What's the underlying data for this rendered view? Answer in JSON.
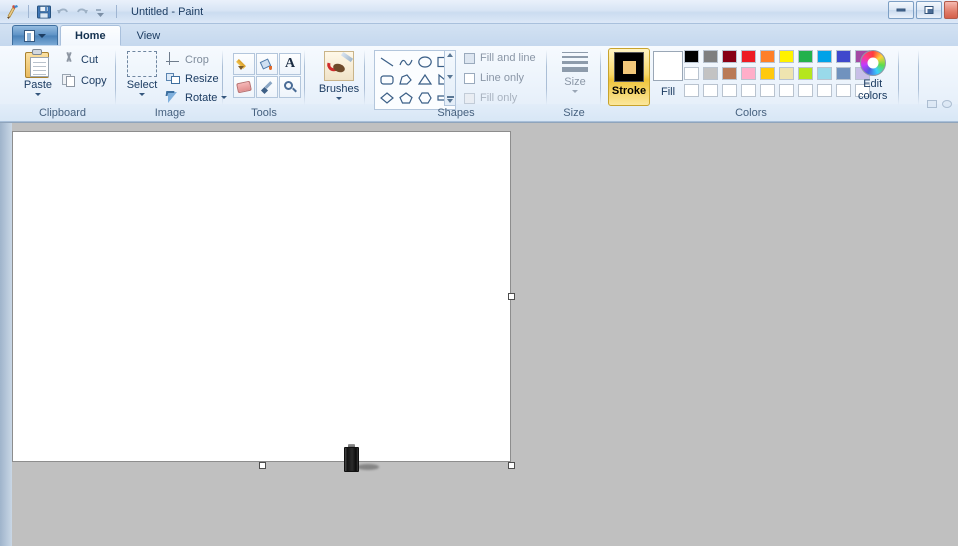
{
  "window": {
    "title": "Untitled - Paint",
    "quick_access": [
      {
        "name": "paint-app-icon",
        "label": "Paint"
      },
      {
        "name": "save-icon",
        "label": "Save"
      },
      {
        "name": "undo-icon",
        "label": "Undo"
      },
      {
        "name": "redo-icon",
        "label": "Redo"
      },
      {
        "name": "customize-qat-icon",
        "label": "Customize Quick Access Toolbar"
      }
    ],
    "controls": [
      {
        "name": "minimize-button",
        "label": "Minimize"
      },
      {
        "name": "restore-button",
        "label": "Restore Down"
      },
      {
        "name": "close-button",
        "label": "Close"
      }
    ]
  },
  "tabs": {
    "app_button_label": "File",
    "items": [
      {
        "label": "Home",
        "active": true
      },
      {
        "label": "View",
        "active": false
      }
    ]
  },
  "ribbon": {
    "groups": [
      {
        "label": "Clipboard"
      },
      {
        "label": "Image"
      },
      {
        "label": "Tools"
      },
      {
        "label": "Shapes"
      },
      {
        "label": "Size"
      },
      {
        "label": "Colors"
      }
    ],
    "clipboard": {
      "paste_label": "Paste",
      "cut_label": "Cut",
      "copy_label": "Copy"
    },
    "image": {
      "select_label": "Select",
      "crop_label": "Crop",
      "resize_label": "Resize",
      "rotate_label": "Rotate"
    },
    "tools": {
      "items": [
        {
          "name": "pencil-tool",
          "label": "Pencil"
        },
        {
          "name": "fill-tool",
          "label": "Fill with color"
        },
        {
          "name": "text-tool",
          "label": "Text"
        },
        {
          "name": "eraser-tool",
          "label": "Eraser"
        },
        {
          "name": "color-picker-tool",
          "label": "Color picker"
        },
        {
          "name": "magnifier-tool",
          "label": "Magnifier"
        }
      ],
      "text_glyph": "A"
    },
    "brushes": {
      "label": "Brushes"
    },
    "shapes": {
      "items": [
        {
          "name": "shape-line",
          "label": "Line"
        },
        {
          "name": "shape-curve",
          "label": "Curve"
        },
        {
          "name": "shape-oval",
          "label": "Oval"
        },
        {
          "name": "shape-rectangle",
          "label": "Rectangle"
        },
        {
          "name": "shape-rounded-rectangle",
          "label": "Rounded rectangle"
        },
        {
          "name": "shape-polygon",
          "label": "Polygon"
        },
        {
          "name": "shape-triangle",
          "label": "Triangle"
        },
        {
          "name": "shape-right-triangle",
          "label": "Right triangle"
        },
        {
          "name": "shape-diamond",
          "label": "Diamond"
        },
        {
          "name": "shape-pentagon",
          "label": "Pentagon"
        },
        {
          "name": "shape-hexagon",
          "label": "Hexagon"
        },
        {
          "name": "shape-right-arrow",
          "label": "Right arrow"
        }
      ],
      "fill_options": [
        {
          "label": "Fill and line",
          "disabled": false
        },
        {
          "label": "Line only",
          "disabled": false
        },
        {
          "label": "Fill only",
          "disabled": true
        }
      ]
    },
    "size": {
      "label": "Size"
    },
    "colors": {
      "stroke_label": "Stroke",
      "fill_label": "Fill",
      "stroke_color": "#000000",
      "stroke_inner_color": "#f2c87a",
      "fill_color": "#ffffff",
      "stroke_selected": true,
      "edit_colors_label_line1": "Edit",
      "edit_colors_label_line2": "colors",
      "palette_rows": [
        [
          "#000000",
          "#7f7f7f",
          "#880015",
          "#ed1c24",
          "#ff7f27",
          "#fff200",
          "#22b14c",
          "#00a2e8",
          "#3f48cc",
          "#a349a4"
        ],
        [
          "#ffffff",
          "#c3c3c3",
          "#b97a57",
          "#ffaec9",
          "#ffc90e",
          "#efe4b0",
          "#b5e61d",
          "#99d9ea",
          "#7092be",
          "#c8bfe7"
        ],
        [
          "#ffffff",
          "#ffffff",
          "#ffffff",
          "#ffffff",
          "#ffffff",
          "#ffffff",
          "#ffffff",
          "#ffffff",
          "#ffffff",
          "#ffffff"
        ]
      ]
    }
  },
  "canvas": {
    "background_color": "#ffffff",
    "workspace_color": "#c0c0c0",
    "handles": [
      {
        "name": "canvas-handle-right-middle"
      },
      {
        "name": "canvas-handle-bottom-center"
      },
      {
        "name": "canvas-handle-bottom-right"
      }
    ],
    "object": {
      "name": "battery-object",
      "label": "Battery drawing"
    }
  }
}
